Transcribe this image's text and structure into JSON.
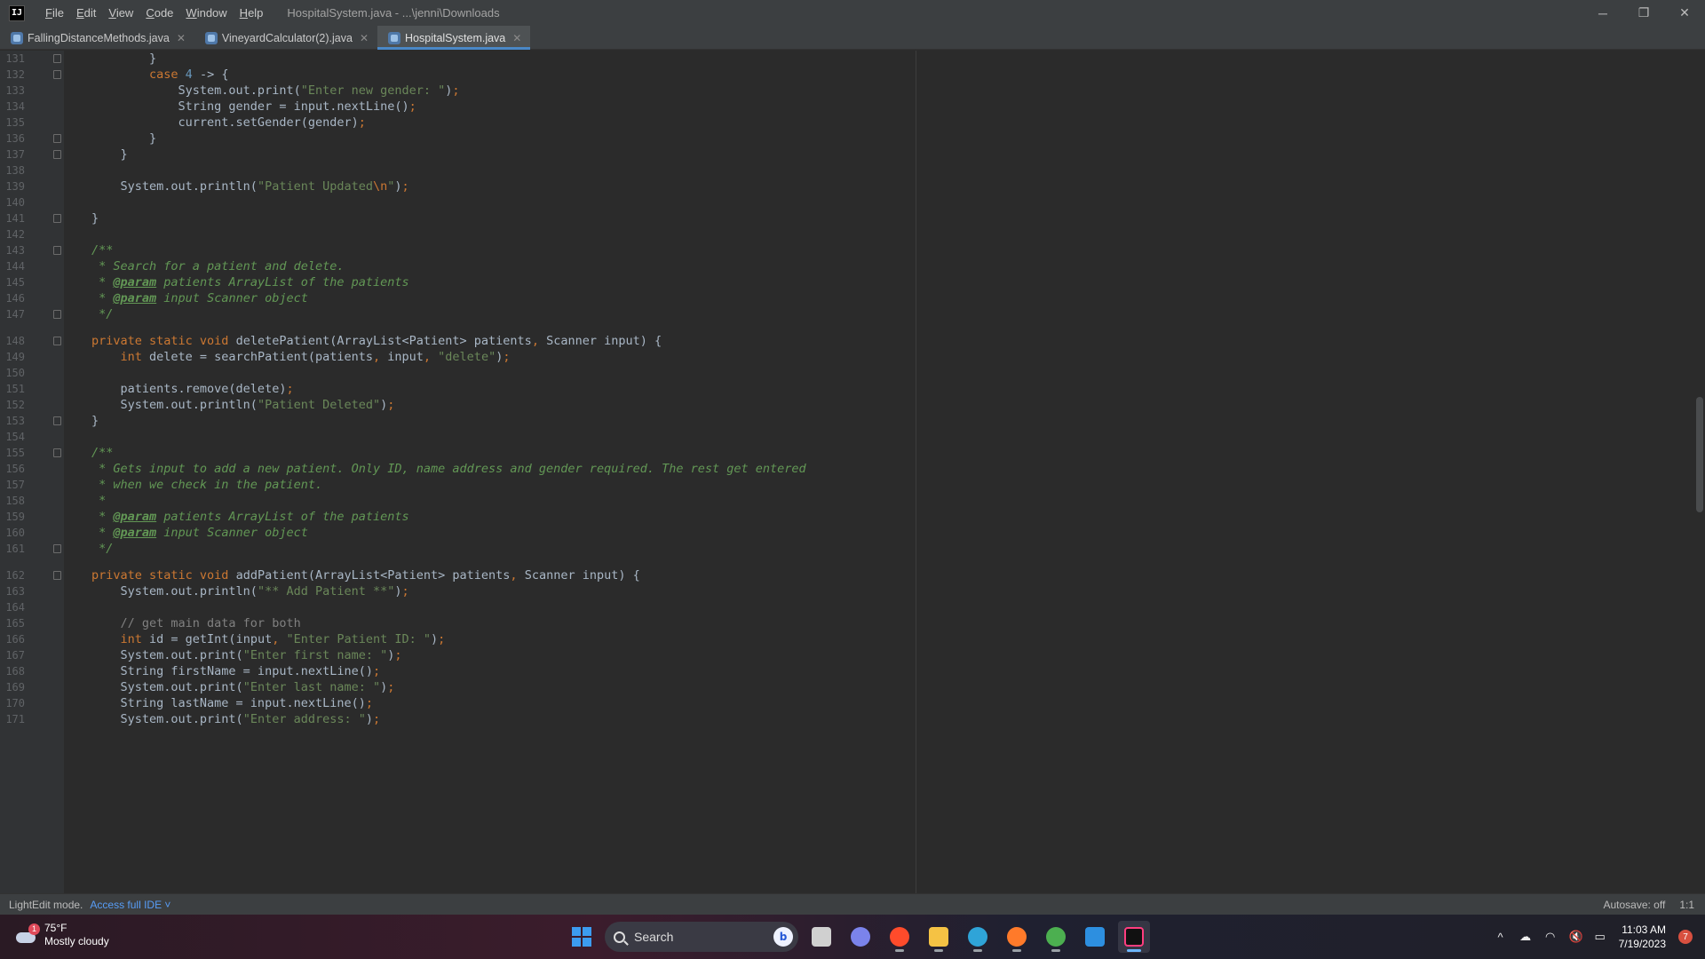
{
  "titlebar": {
    "logo": "IJ",
    "menu": [
      {
        "mnemonic": "F",
        "rest": "ile"
      },
      {
        "mnemonic": "E",
        "rest": "dit"
      },
      {
        "mnemonic": "V",
        "rest": "iew"
      },
      {
        "mnemonic": "C",
        "rest": "ode"
      },
      {
        "mnemonic": "W",
        "rest": "indow"
      },
      {
        "mnemonic": "H",
        "rest": "elp"
      }
    ],
    "title": "HospitalSystem.java - ...\\jenni\\Downloads",
    "minimize": "─",
    "restore": "❐",
    "close": "✕"
  },
  "tabs": [
    {
      "label": "FallingDistanceMethods.java",
      "active": false
    },
    {
      "label": "VineyardCalculator(2).java",
      "active": false
    },
    {
      "label": "HospitalSystem.java",
      "active": true
    }
  ],
  "tab_close": "✕",
  "editor": {
    "lines": [
      {
        "n": "131",
        "fold": true,
        "code": [
          [
            "t",
            "        }"
          ]
        ]
      },
      {
        "n": "132",
        "fold": true,
        "code": [
          [
            "t",
            "        "
          ],
          [
            "kw",
            "case "
          ],
          [
            "num",
            "4"
          ],
          [
            "t",
            " -> {"
          ]
        ]
      },
      {
        "n": "133",
        "code": [
          [
            "t",
            "            System.out.print("
          ],
          [
            "str",
            "\"Enter new gender: \""
          ],
          [
            "t",
            ")"
          ],
          [
            "kw",
            ";"
          ]
        ]
      },
      {
        "n": "134",
        "code": [
          [
            "t",
            "            String gender = input.nextLine()"
          ],
          [
            "kw",
            ";"
          ]
        ]
      },
      {
        "n": "135",
        "code": [
          [
            "t",
            "            current.setGender(gender)"
          ],
          [
            "kw",
            ";"
          ]
        ]
      },
      {
        "n": "136",
        "fold": true,
        "code": [
          [
            "t",
            "        }"
          ]
        ]
      },
      {
        "n": "137",
        "fold": true,
        "code": [
          [
            "t",
            "    }"
          ]
        ]
      },
      {
        "n": "138",
        "code": []
      },
      {
        "n": "139",
        "code": [
          [
            "t",
            "    System.out.println("
          ],
          [
            "str",
            "\"Patient Updated"
          ],
          [
            "kw",
            "\\n"
          ],
          [
            "str",
            "\""
          ],
          [
            "t",
            ")"
          ],
          [
            "kw",
            ";"
          ]
        ]
      },
      {
        "n": "140",
        "code": []
      },
      {
        "n": "141",
        "fold": true,
        "code": [
          [
            "t",
            "}"
          ]
        ]
      },
      {
        "n": "142",
        "code": []
      },
      {
        "n": "143",
        "fold": true,
        "code": [
          [
            "doc",
            "/**"
          ]
        ]
      },
      {
        "n": "144",
        "code": [
          [
            "doc",
            " * Search for a patient and delete."
          ]
        ]
      },
      {
        "n": "145",
        "code": [
          [
            "doc",
            " * "
          ],
          [
            "tag",
            "@param"
          ],
          [
            "doc",
            " patients ArrayList of the patients"
          ]
        ]
      },
      {
        "n": "146",
        "code": [
          [
            "doc",
            " * "
          ],
          [
            "tag",
            "@param"
          ],
          [
            "doc",
            " input Scanner object"
          ]
        ]
      },
      {
        "n": "147",
        "fold": true,
        "code": [
          [
            "doc",
            " */"
          ]
        ]
      },
      {
        "n": "148",
        "fold": true,
        "gap": true,
        "code": [
          [
            "kw",
            "private static void "
          ],
          [
            "t",
            "deletePatient(ArrayList<Patient> patients"
          ],
          [
            "kw",
            ", "
          ],
          [
            "t",
            "Scanner input) {"
          ]
        ]
      },
      {
        "n": "149",
        "code": [
          [
            "t",
            "    "
          ],
          [
            "kw",
            "int "
          ],
          [
            "t",
            "delete = searchPatient(patients"
          ],
          [
            "kw",
            ", "
          ],
          [
            "t",
            "input"
          ],
          [
            "kw",
            ", "
          ],
          [
            "str",
            "\"delete\""
          ],
          [
            "t",
            ")"
          ],
          [
            "kw",
            ";"
          ]
        ]
      },
      {
        "n": "150",
        "code": []
      },
      {
        "n": "151",
        "code": [
          [
            "t",
            "    patients.remove(delete)"
          ],
          [
            "kw",
            ";"
          ]
        ]
      },
      {
        "n": "152",
        "code": [
          [
            "t",
            "    System.out.println("
          ],
          [
            "str",
            "\"Patient Deleted\""
          ],
          [
            "t",
            ")"
          ],
          [
            "kw",
            ";"
          ]
        ]
      },
      {
        "n": "153",
        "fold": true,
        "code": [
          [
            "t",
            "}"
          ]
        ]
      },
      {
        "n": "154",
        "code": []
      },
      {
        "n": "155",
        "fold": true,
        "code": [
          [
            "doc",
            "/**"
          ]
        ]
      },
      {
        "n": "156",
        "code": [
          [
            "doc",
            " * Gets input to add a new patient. Only ID, name address and gender required. The rest get entered"
          ]
        ]
      },
      {
        "n": "157",
        "code": [
          [
            "doc",
            " * when we check in the patient."
          ]
        ]
      },
      {
        "n": "158",
        "code": [
          [
            "doc",
            " *"
          ]
        ]
      },
      {
        "n": "159",
        "code": [
          [
            "doc",
            " * "
          ],
          [
            "tag",
            "@param"
          ],
          [
            "doc",
            " patients ArrayList of the patients"
          ]
        ]
      },
      {
        "n": "160",
        "code": [
          [
            "doc",
            " * "
          ],
          [
            "tag",
            "@param"
          ],
          [
            "doc",
            " input Scanner object"
          ]
        ]
      },
      {
        "n": "161",
        "fold": true,
        "code": [
          [
            "doc",
            " */"
          ]
        ]
      },
      {
        "n": "162",
        "fold": true,
        "gap": true,
        "code": [
          [
            "kw",
            "private static void "
          ],
          [
            "t",
            "addPatient(ArrayList<Patient> patients"
          ],
          [
            "kw",
            ", "
          ],
          [
            "t",
            "Scanner input) {"
          ]
        ]
      },
      {
        "n": "163",
        "code": [
          [
            "t",
            "    System.out.println("
          ],
          [
            "str",
            "\"** Add Patient **\""
          ],
          [
            "t",
            ")"
          ],
          [
            "kw",
            ";"
          ]
        ]
      },
      {
        "n": "164",
        "code": []
      },
      {
        "n": "165",
        "code": [
          [
            "cmt",
            "    // get main data for both"
          ]
        ]
      },
      {
        "n": "166",
        "code": [
          [
            "t",
            "    "
          ],
          [
            "kw",
            "int "
          ],
          [
            "t",
            "id = getInt(input"
          ],
          [
            "kw",
            ", "
          ],
          [
            "str",
            "\"Enter Patient ID: \""
          ],
          [
            "t",
            ")"
          ],
          [
            "kw",
            ";"
          ]
        ]
      },
      {
        "n": "167",
        "code": [
          [
            "t",
            "    System.out.print("
          ],
          [
            "str",
            "\"Enter first name: \""
          ],
          [
            "t",
            ")"
          ],
          [
            "kw",
            ";"
          ]
        ]
      },
      {
        "n": "168",
        "code": [
          [
            "t",
            "    String firstName = input.nextLine()"
          ],
          [
            "kw",
            ";"
          ]
        ]
      },
      {
        "n": "169",
        "code": [
          [
            "t",
            "    System.out.print("
          ],
          [
            "str",
            "\"Enter last name: \""
          ],
          [
            "t",
            ")"
          ],
          [
            "kw",
            ";"
          ]
        ]
      },
      {
        "n": "170",
        "code": [
          [
            "t",
            "    String lastName = input.nextLine()"
          ],
          [
            "kw",
            ";"
          ]
        ]
      },
      {
        "n": "171",
        "code": [
          [
            "t",
            "    System.out.print("
          ],
          [
            "str",
            "\"Enter address: \""
          ],
          [
            "t",
            ")"
          ],
          [
            "kw",
            ";"
          ]
        ]
      }
    ]
  },
  "statusbar": {
    "mode": "LightEdit mode.",
    "link": "Access full IDE ˅",
    "autosave": "Autosave: off",
    "position": "1:1"
  },
  "taskbar": {
    "weather_badge": "1",
    "temperature": "75°F",
    "condition": "Mostly cloudy",
    "search_placeholder": "Search",
    "bing": "b",
    "time": "11:03 AM",
    "date": "7/19/2023",
    "notifications": "7",
    "tray_up": "^",
    "tray_onedrive": "☁",
    "tray_wifi": "◠",
    "tray_volume": "🔇",
    "tray_battery": "▭",
    "apps": [
      {
        "name": "task-view",
        "color": "#d0d0d0"
      },
      {
        "name": "teams-chat",
        "color": "#7b83eb"
      },
      {
        "name": "ea-app",
        "color": "#ff4b2b"
      },
      {
        "name": "file-explorer",
        "color": "#f5c244"
      },
      {
        "name": "edge",
        "color": "#2fa4d8"
      },
      {
        "name": "firefox",
        "color": "#ff7a2a"
      },
      {
        "name": "chrome",
        "color": "#4caf50"
      },
      {
        "name": "vscode",
        "color": "#2d8fe0"
      },
      {
        "name": "intellij",
        "color": "#111111"
      }
    ]
  },
  "colors": {
    "keyword": "#cc7832",
    "string": "#6a8759",
    "number": "#6897bb",
    "doc_comment": "#629755",
    "accent": "#4a88c7"
  }
}
